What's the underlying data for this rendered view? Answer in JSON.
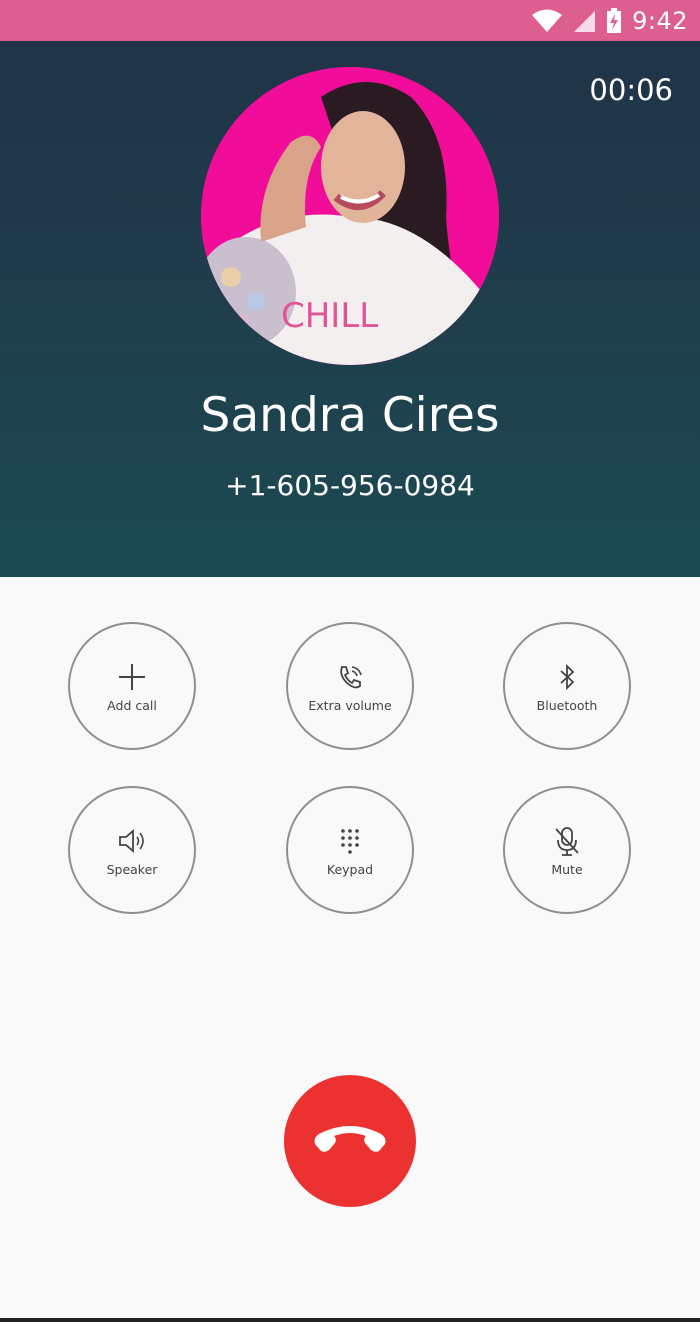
{
  "status_bar": {
    "time": "9:42",
    "icons": [
      "wifi-icon",
      "signal-icon",
      "battery-charging-icon"
    ]
  },
  "call": {
    "timer": "00:06",
    "contact_name": "Sandra Cires",
    "phone_number": "+1-605-956-0984"
  },
  "controls": [
    {
      "label": "Add call",
      "icon": "plus-icon"
    },
    {
      "label": "Extra volume",
      "icon": "phone-volume-icon"
    },
    {
      "label": "Bluetooth",
      "icon": "bluetooth-icon"
    },
    {
      "label": "Speaker",
      "icon": "speaker-icon"
    },
    {
      "label": "Keypad",
      "icon": "keypad-icon"
    },
    {
      "label": "Mute",
      "icon": "mic-off-icon"
    }
  ],
  "end_call": {
    "icon": "end-call-icon"
  },
  "colors": {
    "status_bar": "#dc5f8f",
    "header_top": "#213348",
    "header_bottom": "#1b4a51",
    "end_call": "#ec3131",
    "avatar_bg": "#f20c9a"
  }
}
